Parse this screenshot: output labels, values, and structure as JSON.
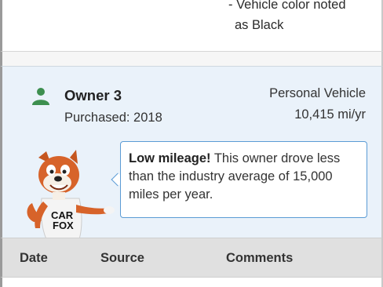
{
  "previous_record": {
    "line1": "- Vehicle color noted",
    "line2": "as Black"
  },
  "owner": {
    "title": "Owner 3",
    "purchased": "Purchased: 2018",
    "vehicle_type": "Personal Vehicle",
    "mileage": "10,415 mi/yr",
    "icon": "person-icon",
    "icon_color": "#3d8f4f"
  },
  "callout": {
    "emphasis": "Low mileage!",
    "text": " This owner drove less than the industry average of 15,000 miles per year.",
    "border_color": "#5b9bd5"
  },
  "mascot": {
    "shirt_text_line1": "CAR",
    "shirt_text_line2": "FOX"
  },
  "table": {
    "headers": [
      "Date",
      "Source",
      "Comments"
    ]
  }
}
